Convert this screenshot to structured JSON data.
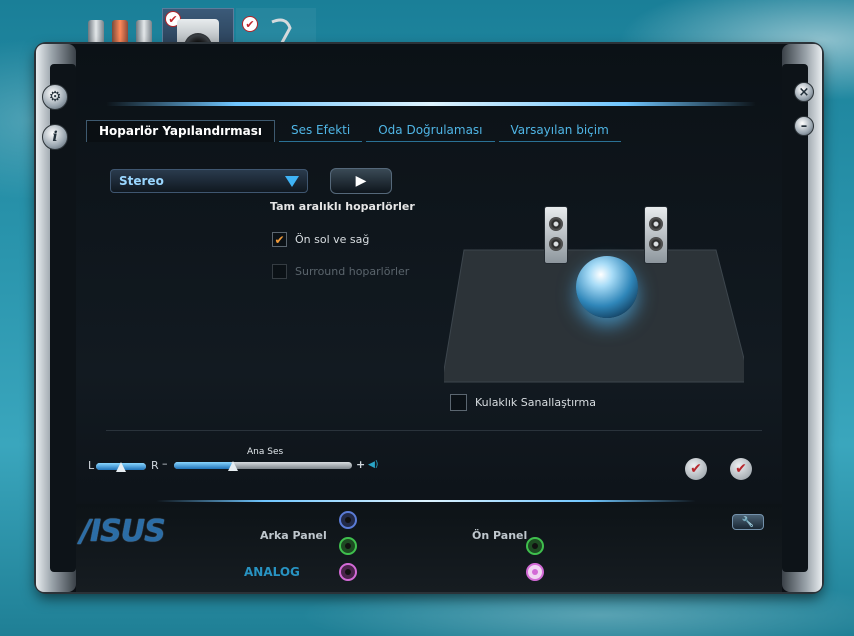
{
  "tabs": [
    {
      "label": "Hoparlör Yapılandırması",
      "active": true
    },
    {
      "label": "Ses Efekti",
      "active": false
    },
    {
      "label": "Oda Doğrulaması",
      "active": false
    },
    {
      "label": "Varsayılan biçim",
      "active": false
    }
  ],
  "speaker_config": {
    "dropdown_value": "Stereo",
    "play_icon": "▶",
    "section_label": "Tam aralıklı hoparlörler",
    "front_lr_label": "Ön sol ve sağ",
    "front_lr_checked": true,
    "surround_label": "Surround hoparlörler",
    "surround_checked": false,
    "headphone_label": "Kulaklık Sanallaştırma",
    "headphone_checked": false
  },
  "volume": {
    "balance_left": "L",
    "balance_right": "R",
    "balance_value": 0.5,
    "main_label": "Ana Ses",
    "minus": "–",
    "plus": "+",
    "main_value": 0.33
  },
  "side_buttons": {
    "gear_icon": "gear-icon",
    "info_icon": "i",
    "close_icon": "×",
    "minimize_icon": "–"
  },
  "action_buttons": {
    "ok1": "✔",
    "ok2": "✔"
  },
  "footer": {
    "logo": "/ISUS",
    "back_panel": "Arka Panel",
    "front_panel": "Ön Panel",
    "analog": "ANALOG",
    "wrench_icon": "🔧"
  },
  "colors": {
    "accent": "#4fb5e5",
    "check": "#f09a3a",
    "port_blue": "#5a7bd6",
    "port_green": "#3fbf4d",
    "port_pink": "#d36ad6"
  }
}
